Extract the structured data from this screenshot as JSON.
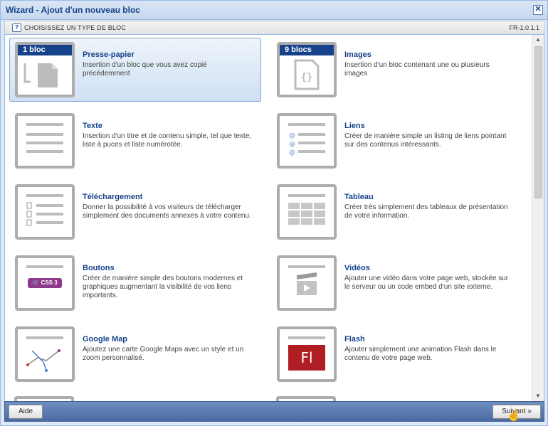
{
  "window": {
    "title": "Wizard - Ajout d'un nouveau bloc",
    "close_label": "✕"
  },
  "subheader": {
    "label": "CHOISISSEZ UN TYPE DE BLOC",
    "version": "FR-1.0.1.1",
    "help_glyph": "?"
  },
  "blocks": [
    {
      "id": "presse",
      "title": "Presse-papier",
      "badge": "1 bloc",
      "desc": "Insertion d'un bloc que vous avez copié précédemment",
      "icon": "document-icon",
      "selected": true
    },
    {
      "id": "images",
      "title": "Images",
      "badge": "9 blocs",
      "desc": "Insertion d'un bloc contenant une ou plusieurs images",
      "icon": "code-file-icon"
    },
    {
      "id": "texte",
      "title": "Texte",
      "desc": "Insertion d'un titre et de contenu simple, tel que texte, liste à puces et liste numérotée.",
      "icon": "text-lines-icon"
    },
    {
      "id": "liens",
      "title": "Liens",
      "desc": "Créer de manière simple un listing de liens pointant sur des contenus intéressants.",
      "icon": "links-icon"
    },
    {
      "id": "telech",
      "title": "Téléchargement",
      "desc": "Donner la possibilité à vos visiteurs de télécharger simplement des documents annexes à votre contenu.",
      "icon": "download-list-icon"
    },
    {
      "id": "tableau",
      "title": "Tableau",
      "desc": "Créer très simplement des tableaux de présentation de votre information.",
      "icon": "table-icon"
    },
    {
      "id": "boutons",
      "title": "Boutons",
      "desc": "Créer de manière simple des boutons modernes et graphiques augmentant la visibilité de vos liens importants.",
      "icon": "button-icon",
      "button_text": "CSS 3"
    },
    {
      "id": "videos",
      "title": "Vidéos",
      "desc": "Ajouter une vidéo dans votre page web, stockée sur le serveur ou un code embed d'un site externe.",
      "icon": "video-icon"
    },
    {
      "id": "gmap",
      "title": "Google Map",
      "desc": "Ajoutez une carte Google Maps avec un style et un zoom personnalisé.",
      "icon": "map-icon"
    },
    {
      "id": "flash",
      "title": "Flash",
      "desc": "Ajouter simplement une animation Flash dans le contenu de votre page web.",
      "icon": "flash-icon",
      "flash_text": "Fl"
    }
  ],
  "footer": {
    "help_label": "Aide",
    "next_label": "Suivant »"
  },
  "colors": {
    "accent": "#15428b",
    "flash_red": "#b01e24",
    "button_purple": "#8e3a8c",
    "thumb_border": "#adadad"
  }
}
